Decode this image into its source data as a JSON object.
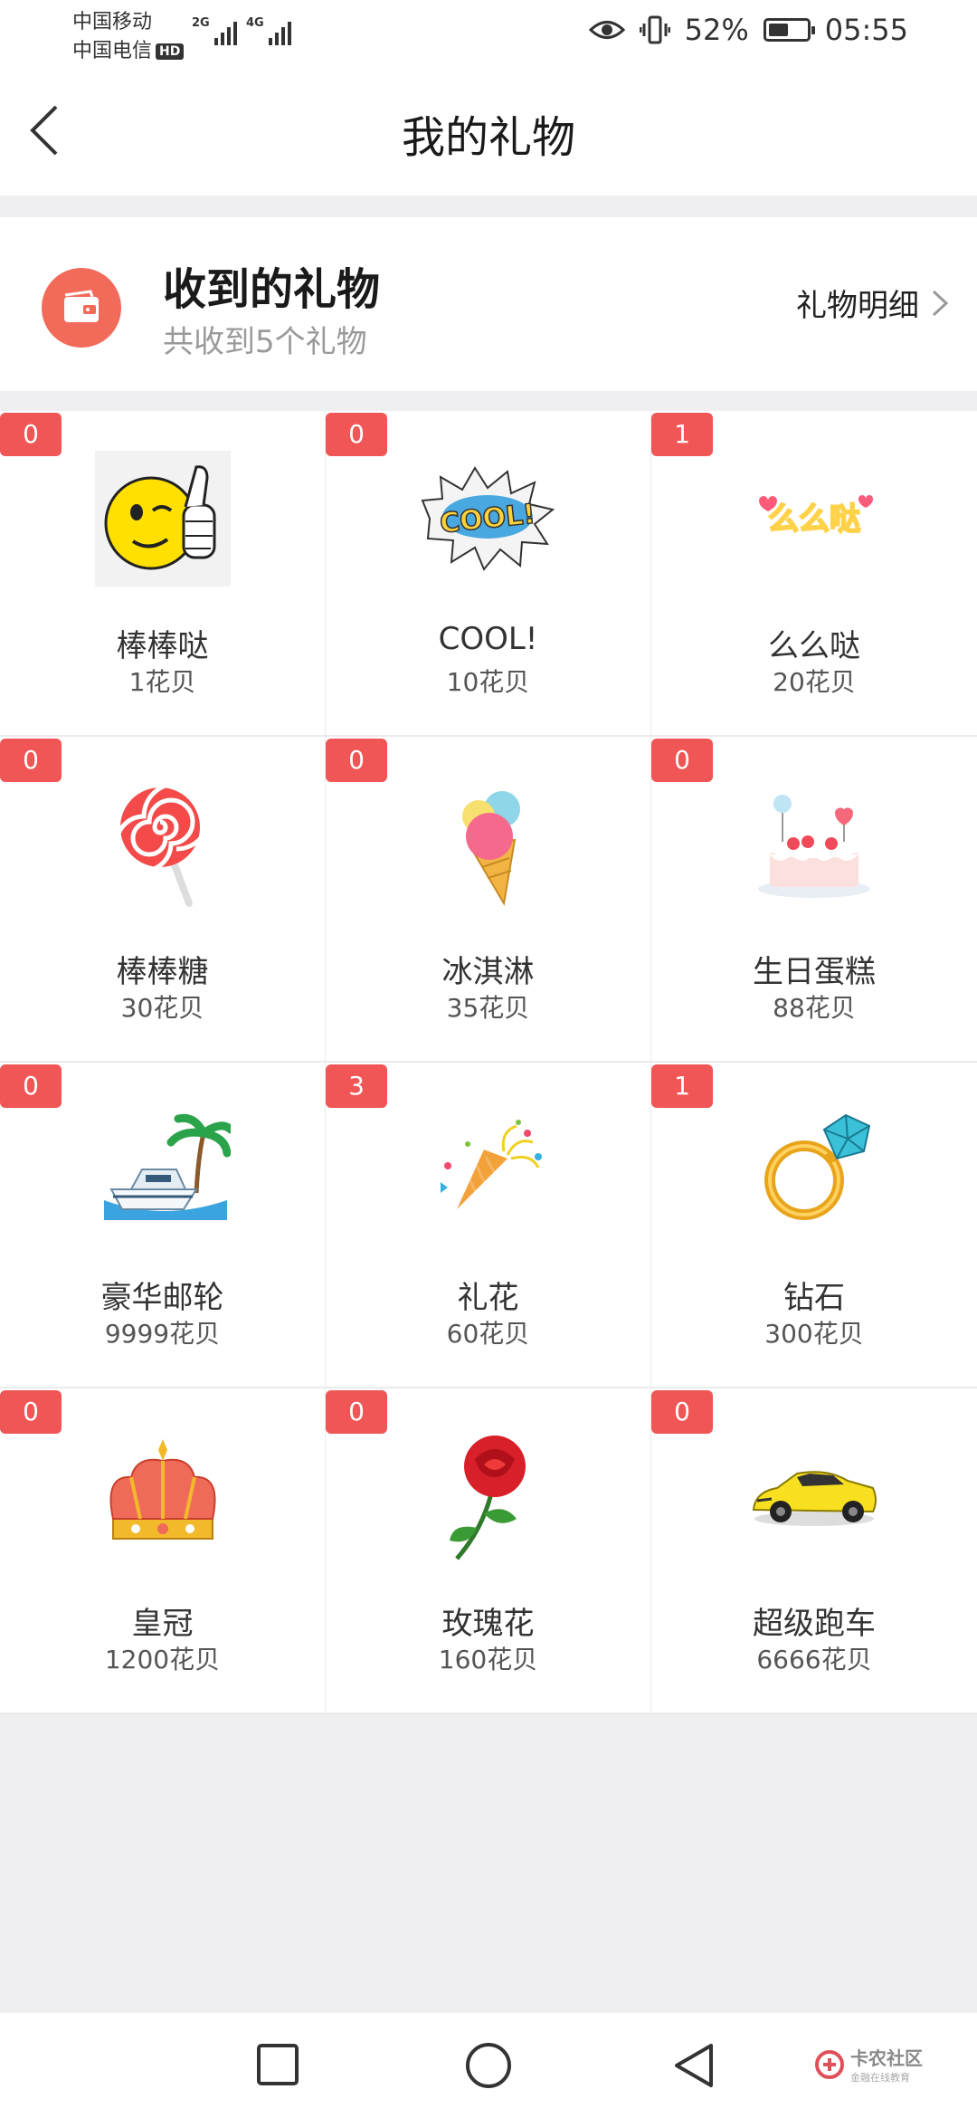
{
  "status_bar": {
    "carrier_1": "中国移动",
    "carrier_2": "中国电信",
    "hd": "HD",
    "signal_1_label": "2G",
    "signal_2_label": "4G",
    "battery_percent": "52%",
    "battery_level": 0.52,
    "time": "05:55"
  },
  "header": {
    "title": "我的礼物"
  },
  "summary": {
    "title": "收到的礼物",
    "subtitle": "共收到5个礼物",
    "detail_link": "礼物明细",
    "icon": "wallet-icon",
    "icon_color": "#f26a5a"
  },
  "badge_color": "#f05656",
  "gifts": [
    {
      "count": "0",
      "name": "棒棒哒",
      "price": "1花贝",
      "icon": "thumbs-up-smiley-icon"
    },
    {
      "count": "0",
      "name": "COOL!",
      "price": "10花贝",
      "icon": "cool-sticker-icon"
    },
    {
      "count": "1",
      "name": "么么哒",
      "price": "20花贝",
      "icon": "kiss-sticker-icon",
      "sticker_text": "么么哒"
    },
    {
      "count": "0",
      "name": "棒棒糖",
      "price": "30花贝",
      "icon": "lollipop-icon"
    },
    {
      "count": "0",
      "name": "冰淇淋",
      "price": "35花贝",
      "icon": "ice-cream-icon"
    },
    {
      "count": "0",
      "name": "生日蛋糕",
      "price": "88花贝",
      "icon": "birthday-cake-icon"
    },
    {
      "count": "0",
      "name": "豪华邮轮",
      "price": "9999花贝",
      "icon": "yacht-icon"
    },
    {
      "count": "3",
      "name": "礼花",
      "price": "60花贝",
      "icon": "party-popper-icon"
    },
    {
      "count": "1",
      "name": "钻石",
      "price": "300花贝",
      "icon": "diamond-ring-icon"
    },
    {
      "count": "0",
      "name": "皇冠",
      "price": "1200花贝",
      "icon": "crown-icon"
    },
    {
      "count": "0",
      "name": "玫瑰花",
      "price": "160花贝",
      "icon": "rose-icon"
    },
    {
      "count": "0",
      "name": "超级跑车",
      "price": "6666花贝",
      "icon": "sports-car-icon"
    }
  ],
  "watermark": {
    "name": "卡农社区",
    "tagline": "金融在线教育"
  },
  "nav": {
    "recent": "square-icon",
    "home": "circle-icon",
    "back": "triangle-back-icon"
  }
}
